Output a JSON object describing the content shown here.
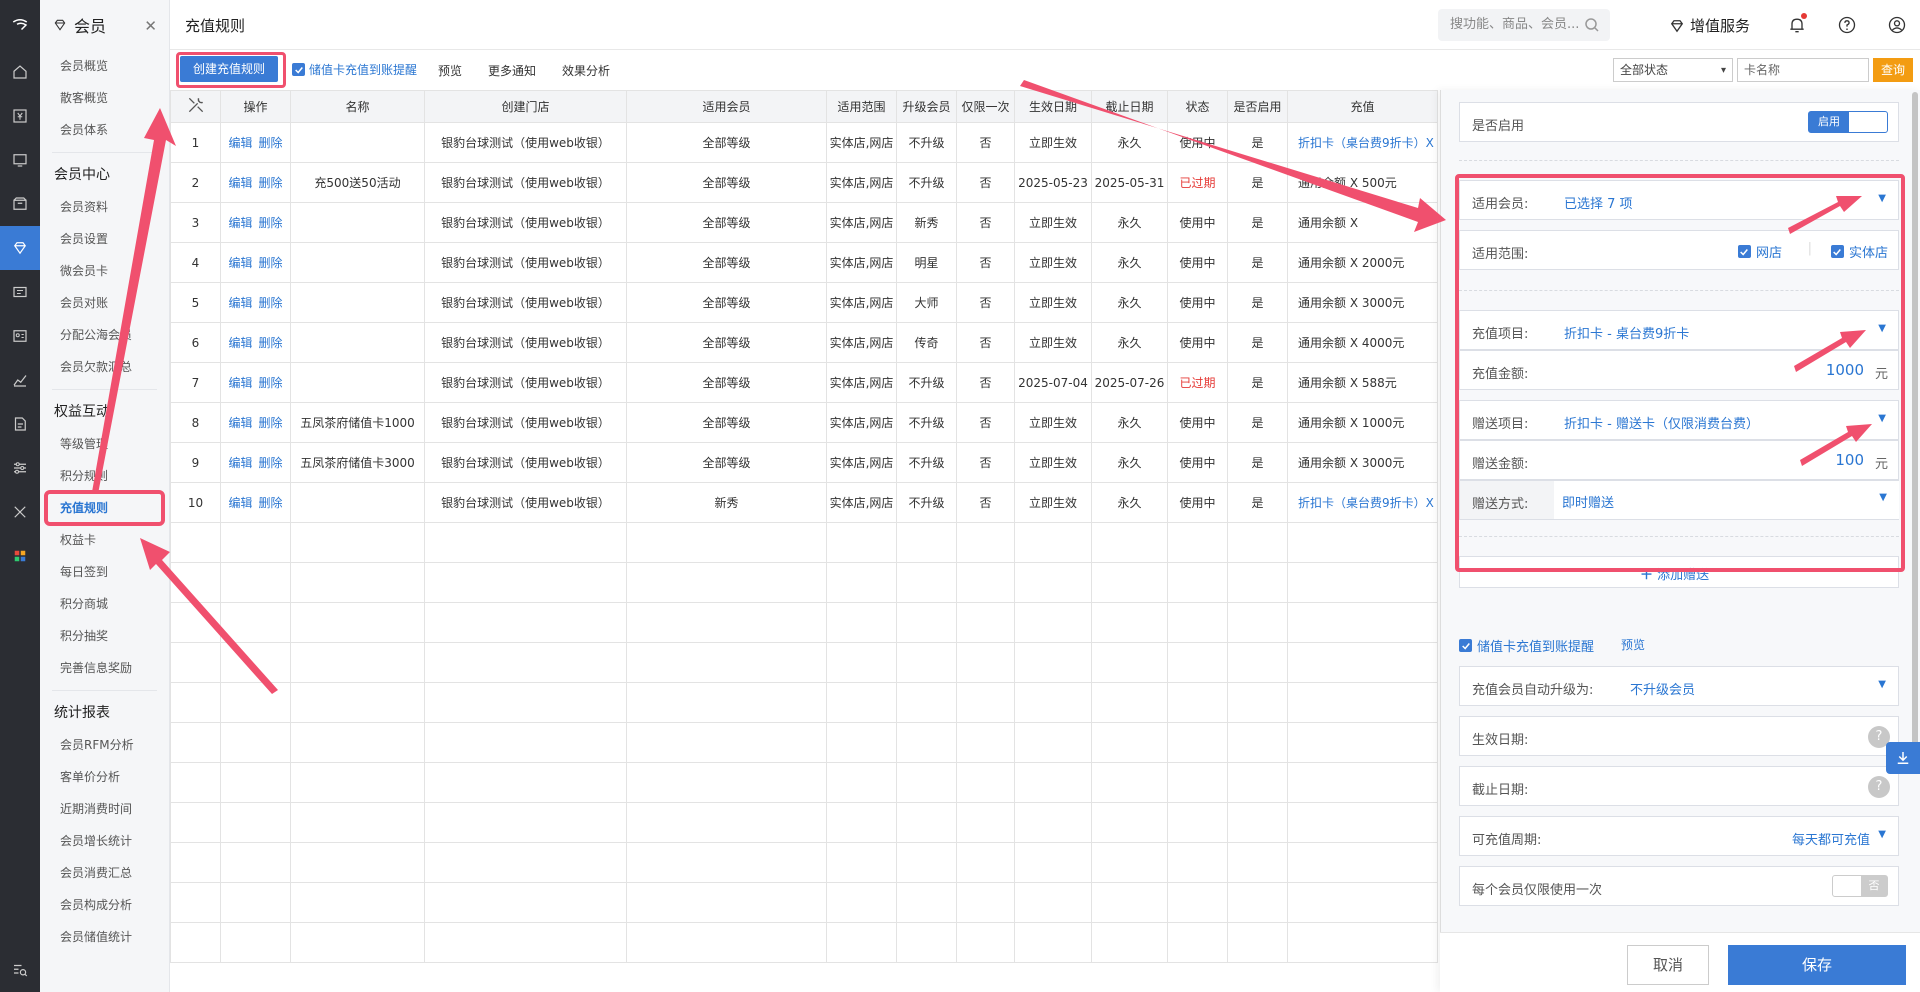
{
  "sidebar": {
    "title": "会员",
    "groups": [
      {
        "items": [
          "会员概览",
          "散客概览",
          "会员体系"
        ]
      },
      {
        "title": "会员中心",
        "items": [
          "会员资料",
          "会员设置",
          "微会员卡",
          "会员对账",
          "分配公海会员",
          "会员欠款汇总"
        ]
      },
      {
        "title": "权益互动",
        "items": [
          "等级管理",
          "积分规则",
          "充值规则",
          "权益卡",
          "每日签到",
          "积分商城",
          "积分抽奖",
          "完善信息奖励"
        ]
      },
      {
        "title": "统计报表",
        "items": [
          "会员RFM分析",
          "客单价分析",
          "近期消费时间",
          "会员增长统计",
          "会员消费汇总",
          "会员构成分析",
          "会员储值统计"
        ]
      }
    ]
  },
  "header": {
    "title": "充值规则",
    "search_placeholder": "搜功能、商品、会员...",
    "value_service": "增值服务"
  },
  "toolbar": {
    "create": "创建充值规则",
    "reminder": "储值卡充值到账提醒",
    "preview": "预览",
    "more_notice": "更多通知",
    "effect": "效果分析",
    "status_select": "全部状态",
    "card_name_placeholder": "卡名称",
    "query": "查询"
  },
  "table": {
    "columns": [
      "",
      "操作",
      "名称",
      "创建门店",
      "适用会员",
      "适用范围",
      "升级会员",
      "仅限一次",
      "生效日期",
      "截止日期",
      "状态",
      "是否启用",
      "充值"
    ],
    "edit": "编辑",
    "delete": "删除",
    "rows": [
      [
        "1",
        "",
        "银豹台球测试（使用web收银）",
        "全部等级",
        "实体店,网店",
        "不升级",
        "否",
        "立即生效",
        "永久",
        "使用中",
        "是",
        "折扣卡（桌台费9折卡）X"
      ],
      [
        "2",
        "充500送50活动",
        "银豹台球测试（使用web收银）",
        "全部等级",
        "实体店,网店",
        "不升级",
        "否",
        "2025-05-23",
        "2025-05-31",
        "已过期",
        "是",
        "通用余额 X 500元"
      ],
      [
        "3",
        "",
        "银豹台球测试（使用web收银）",
        "全部等级",
        "实体店,网店",
        "新秀",
        "否",
        "立即生效",
        "永久",
        "使用中",
        "是",
        "通用余额 X"
      ],
      [
        "4",
        "",
        "银豹台球测试（使用web收银）",
        "全部等级",
        "实体店,网店",
        "明星",
        "否",
        "立即生效",
        "永久",
        "使用中",
        "是",
        "通用余额 X 2000元"
      ],
      [
        "5",
        "",
        "银豹台球测试（使用web收银）",
        "全部等级",
        "实体店,网店",
        "大师",
        "否",
        "立即生效",
        "永久",
        "使用中",
        "是",
        "通用余额 X 3000元"
      ],
      [
        "6",
        "",
        "银豹台球测试（使用web收银）",
        "全部等级",
        "实体店,网店",
        "传奇",
        "否",
        "立即生效",
        "永久",
        "使用中",
        "是",
        "通用余额 X 4000元"
      ],
      [
        "7",
        "",
        "银豹台球测试（使用web收银）",
        "全部等级",
        "实体店,网店",
        "不升级",
        "否",
        "2025-07-04",
        "2025-07-26",
        "已过期",
        "是",
        "通用余额 X 588元"
      ],
      [
        "8",
        "五凤茶府储值卡1000",
        "银豹台球测试（使用web收银）",
        "全部等级",
        "实体店,网店",
        "不升级",
        "否",
        "立即生效",
        "永久",
        "使用中",
        "是",
        "通用余额 X 1000元"
      ],
      [
        "9",
        "五凤茶府储值卡3000",
        "银豹台球测试（使用web收银）",
        "全部等级",
        "实体店,网店",
        "不升级",
        "否",
        "立即生效",
        "永久",
        "使用中",
        "是",
        "通用余额 X 3000元"
      ],
      [
        "10",
        "",
        "银豹台球测试（使用web收银）",
        "新秀",
        "实体店,网店",
        "不升级",
        "否",
        "立即生效",
        "永久",
        "使用中",
        "是",
        "折扣卡（桌台费9折卡）X"
      ]
    ]
  },
  "drawer": {
    "enabled_label": "是否启用",
    "enabled_on": "启用",
    "members_label": "适用会员:",
    "members_value": "已选择 7 项",
    "scope_label": "适用范围:",
    "scope_online": "网店",
    "scope_offline": "实体店",
    "recharge_item_label": "充值项目:",
    "recharge_item_value": "折扣卡 - 桌台费9折卡",
    "recharge_amount_label": "充值金额:",
    "recharge_amount_value": "1000",
    "gift_item_label": "赠送项目:",
    "gift_item_value": "折扣卡 - 赠送卡（仅限消费台费）",
    "gift_amount_label": "赠送金额:",
    "gift_amount_value": "100",
    "currency": "元",
    "gift_mode_label": "赠送方式:",
    "gift_mode_value": "即时赠送",
    "add_gift": "添加赠送",
    "reminder": "储值卡充值到账提醒",
    "preview": "预览",
    "auto_upgrade_label": "充值会员自动升级为:",
    "auto_upgrade_value": "不升级会员",
    "start_date_label": "生效日期:",
    "end_date_label": "截止日期:",
    "cycle_label": "可充值周期:",
    "cycle_value": "每天都可充值",
    "once_label": "每个会员仅限使用一次",
    "once_off": "否",
    "qmark": "?",
    "cancel": "取消",
    "save": "保存"
  },
  "colors": {
    "accent": "#3a7bd5",
    "annotation": "#f0506e",
    "expired": "#e53935",
    "query": "#f39c12"
  }
}
